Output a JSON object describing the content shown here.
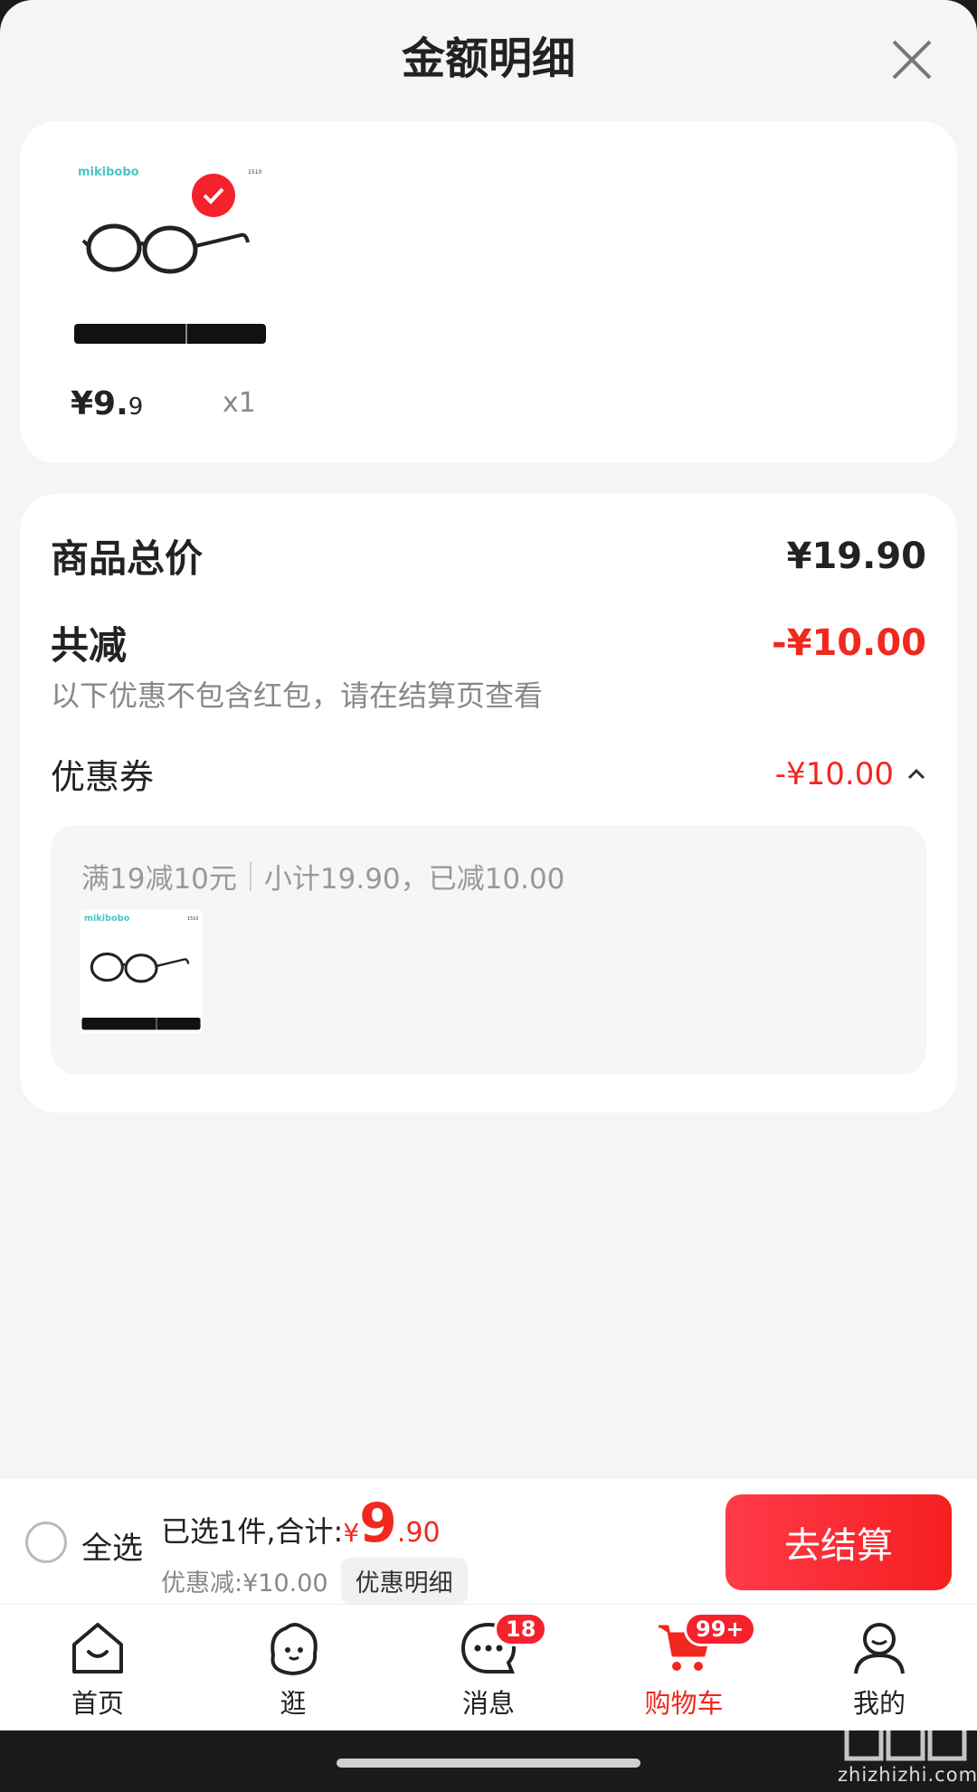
{
  "sheet": {
    "title": "金额明细",
    "close_icon": "close-icon"
  },
  "product": {
    "brand": "mikibobo",
    "model": "1510",
    "price_main": "¥9.",
    "price_frac": "9",
    "quantity": "x1",
    "selected": true
  },
  "summary": {
    "total_label": "商品总价",
    "total_value": "¥19.90",
    "reduce_label": "共减",
    "reduce_value": "-¥10.00",
    "hint": "以下优惠不包含红包，请在结算页查看",
    "coupon_label": "优惠券",
    "coupon_value": "-¥10.00",
    "coupon_rule": "满19减10元",
    "coupon_detail": "小计19.90，已减10.00"
  },
  "bottom_bar": {
    "select_all": "全选",
    "total_prefix": "已选1件,合计:",
    "currency": "¥",
    "total_int": "9",
    "total_dec": ".90",
    "discount_text": "优惠减:¥10.00",
    "detail_button": "优惠明细",
    "checkout_button": "去结算"
  },
  "tabbar": {
    "tabs": [
      {
        "label": "首页",
        "icon": "home-icon"
      },
      {
        "label": "逛",
        "icon": "browse-icon"
      },
      {
        "label": "消息",
        "icon": "message-icon",
        "badge": "18"
      },
      {
        "label": "购物车",
        "icon": "cart-icon",
        "badge": "99+",
        "active": true
      },
      {
        "label": "我的",
        "icon": "profile-icon"
      }
    ]
  },
  "watermark": {
    "text": "zhizhizhi.com"
  },
  "colors": {
    "accent": "#f0281e",
    "background": "#f5f5f5"
  }
}
